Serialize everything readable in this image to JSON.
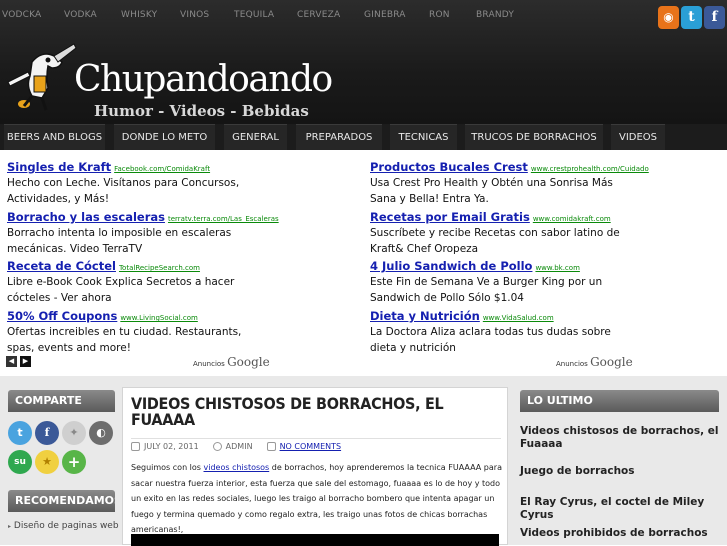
{
  "topnav": [
    "VODCKA",
    "VODKA",
    "WHISKY",
    "VINOS",
    "TEQUILA",
    "CERVEZA",
    "GINEBRA",
    "RON",
    "BRANDY"
  ],
  "social": [
    {
      "icon": "rss-icon",
      "glyph": "◉",
      "color": "#e8731a"
    },
    {
      "icon": "twitter-icon",
      "glyph": "t",
      "color": "#2a9fd6"
    },
    {
      "icon": "facebook-icon",
      "glyph": "f",
      "color": "#3b5998"
    }
  ],
  "site": {
    "title": "Chupandoando",
    "tagline": "Humor -  Videos - Bebidas"
  },
  "mainnav": [
    "BEERS AND BLOGS",
    "DONDE LO METO",
    "GENERAL",
    "PREPARADOS",
    "TECNICAS",
    "TRUCOS DE BORRACHOS",
    "VIDEOS"
  ],
  "ads": {
    "left": [
      {
        "title": "Singles de Kraft",
        "url": "Facebook.com/ComidaKraft",
        "text": "Hecho con Leche. Visítanos para Concursos, Actividades, y Más!"
      },
      {
        "title": "Borracho y las escaleras",
        "url": "terratv.terra.com/Las_Escaleras",
        "text": "Borracho intenta lo imposible en escaleras mecánicas. Video TerraTV"
      },
      {
        "title": "Receta de Cóctel",
        "url": "TotalRecipeSearch.com",
        "text": "Libre e-Book Cook Explica Secretos a hacer cócteles - Ver ahora"
      },
      {
        "title": "50% Off Coupons",
        "url": "www.LivingSocial.com",
        "text": "Ofertas increibles en tu ciudad. Restaurants, spas, events and more!"
      }
    ],
    "right": [
      {
        "title": "Productos Bucales Crest",
        "url": "www.crestprohealth.com/Cuidado",
        "text": "Usa Crest Pro Health y Obtén una Sonrisa Más Sana y Bella! Entra Ya."
      },
      {
        "title": "Recetas por Email Gratis",
        "url": "www.comidakraft.com",
        "text": "Suscríbete y recibe Recetas con sabor latino de Kraft& Chef Oropeza"
      },
      {
        "title": "4 Julio Sandwich de Pollo",
        "url": "www.bk.com",
        "text": "Este Fin de Semana Ve a Burger King por un Sandwich de Pollo Sólo $1.04"
      },
      {
        "title": "Dieta y Nutrición",
        "url": "www.VidaSalud.com",
        "text": "La Doctora Aliza aclara todas tus dudas sobre dieta y nutrición"
      }
    ],
    "anuncios": "Anuncios",
    "google": "Google"
  },
  "left_sidebar": {
    "comparte": "COMPARTE",
    "share_icons": [
      {
        "icon": "twitter-icon",
        "color": "#4aa3df",
        "glyph": "t"
      },
      {
        "icon": "facebook-icon",
        "color": "#3b5998",
        "glyph": "f"
      },
      {
        "icon": "delicious-icon",
        "color": "#c8c8c8",
        "glyph": "✦"
      },
      {
        "icon": "digg-icon",
        "color": "#6d6d6d",
        "glyph": "◐"
      },
      {
        "icon": "stumbleupon-icon",
        "color": "#2fa84f",
        "glyph": "su"
      },
      {
        "icon": "favorite-star-icon",
        "color": "#e3c020",
        "glyph": "★"
      },
      {
        "icon": "add-icon",
        "color": "#58b548",
        "glyph": "+"
      }
    ],
    "recomendamos": "RECOMENDAMOS",
    "recomendamos_link": "Diseño de paginas web"
  },
  "post": {
    "title": "VIDEOS CHISTOSOS DE BORRACHOS, EL FUAAAA",
    "date": "JULY 02, 2011",
    "author": "ADMIN",
    "comments": "NO COMMENTS",
    "body_pre": "Seguimos con los ",
    "body_link": "videos chistosos",
    "body_post": " de borrachos, hoy aprenderemos la tecnica FUAAAA para sacar nuestra fuerza interior, esta fuerza que sale del estomago, fuaaaa es lo de hoy y todo un exito en las redes sociales, luego les traigo al borracho bombero que intenta apagar un fuego y termina quemado y como regalo extra, les traigo unas fotos de chicas borrachas americanas!,"
  },
  "right_sidebar": {
    "heading": "LO ULTIMO",
    "items": [
      "Videos chistosos de borrachos, el Fuaaaa",
      "Juego de borrachos",
      "El Ray Cyrus, el coctel de Miley Cyrus",
      "Videos prohibidos de borrachos"
    ]
  }
}
